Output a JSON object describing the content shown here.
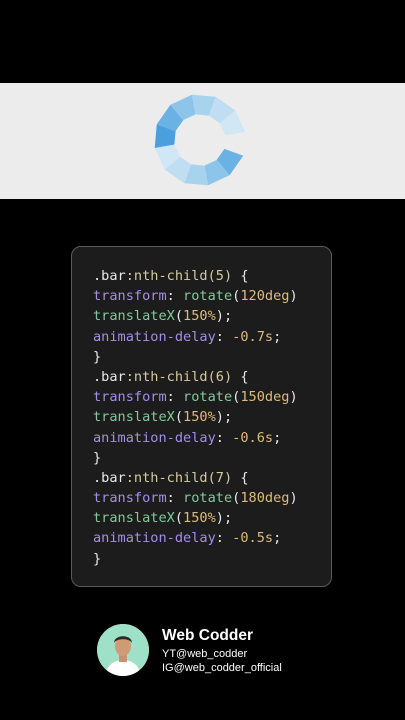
{
  "preview": {
    "background": "#ececec",
    "spinner_colors": [
      "#4a9fdc",
      "#6ab2e4",
      "#8cc4ea",
      "#a8d3ef",
      "#bfdef2",
      "#d2e7f5"
    ]
  },
  "code": {
    "lines": [
      [
        {
          "t": ".bar",
          "c": "sel-class"
        },
        {
          "t": ":nth-child(5)",
          "c": "sel-pseudo"
        },
        {
          "t": " {",
          "c": "brace"
        }
      ],
      [
        {
          "t": "transform",
          "c": "prop"
        },
        {
          "t": ": ",
          "c": "punc"
        },
        {
          "t": "rotate",
          "c": "fn"
        },
        {
          "t": "(",
          "c": "punc"
        },
        {
          "t": "120deg",
          "c": "num"
        },
        {
          "t": ")",
          "c": "punc"
        }
      ],
      [
        {
          "t": "translateX",
          "c": "fn"
        },
        {
          "t": "(",
          "c": "punc"
        },
        {
          "t": "150%",
          "c": "num"
        },
        {
          "t": ");",
          "c": "punc"
        }
      ],
      [
        {
          "t": "animation-delay",
          "c": "prop"
        },
        {
          "t": ": ",
          "c": "punc"
        },
        {
          "t": "-0.7s",
          "c": "num"
        },
        {
          "t": ";",
          "c": "punc"
        }
      ],
      [
        {
          "t": "}",
          "c": "brace"
        }
      ],
      [
        {
          "t": ".bar",
          "c": "sel-class"
        },
        {
          "t": ":nth-child(6)",
          "c": "sel-pseudo"
        },
        {
          "t": " {",
          "c": "brace"
        }
      ],
      [
        {
          "t": "transform",
          "c": "prop"
        },
        {
          "t": ": ",
          "c": "punc"
        },
        {
          "t": "rotate",
          "c": "fn"
        },
        {
          "t": "(",
          "c": "punc"
        },
        {
          "t": "150deg",
          "c": "num"
        },
        {
          "t": ")",
          "c": "punc"
        }
      ],
      [
        {
          "t": "translateX",
          "c": "fn"
        },
        {
          "t": "(",
          "c": "punc"
        },
        {
          "t": "150%",
          "c": "num"
        },
        {
          "t": ");",
          "c": "punc"
        }
      ],
      [
        {
          "t": "animation-delay",
          "c": "prop"
        },
        {
          "t": ": ",
          "c": "punc"
        },
        {
          "t": "-0.6s",
          "c": "num"
        },
        {
          "t": ";",
          "c": "punc"
        }
      ],
      [
        {
          "t": "}",
          "c": "brace"
        }
      ],
      [
        {
          "t": ".bar",
          "c": "sel-class"
        },
        {
          "t": ":nth-child(7)",
          "c": "sel-pseudo"
        },
        {
          "t": " {",
          "c": "brace"
        }
      ],
      [
        {
          "t": "transform",
          "c": "prop"
        },
        {
          "t": ": ",
          "c": "punc"
        },
        {
          "t": "rotate",
          "c": "fn"
        },
        {
          "t": "(",
          "c": "punc"
        },
        {
          "t": "180deg",
          "c": "num"
        },
        {
          "t": ")",
          "c": "punc"
        }
      ],
      [
        {
          "t": "translateX",
          "c": "fn"
        },
        {
          "t": "(",
          "c": "punc"
        },
        {
          "t": "150%",
          "c": "num"
        },
        {
          "t": ");",
          "c": "punc"
        }
      ],
      [
        {
          "t": "animation-delay",
          "c": "prop"
        },
        {
          "t": ": ",
          "c": "punc"
        },
        {
          "t": "-0.5s",
          "c": "num"
        },
        {
          "t": ";",
          "c": "punc"
        }
      ],
      [
        {
          "t": "}",
          "c": "brace"
        }
      ]
    ]
  },
  "profile": {
    "name": "Web Codder",
    "youtube": "YT@web_codder",
    "instagram": "IG@web_codder_official"
  }
}
